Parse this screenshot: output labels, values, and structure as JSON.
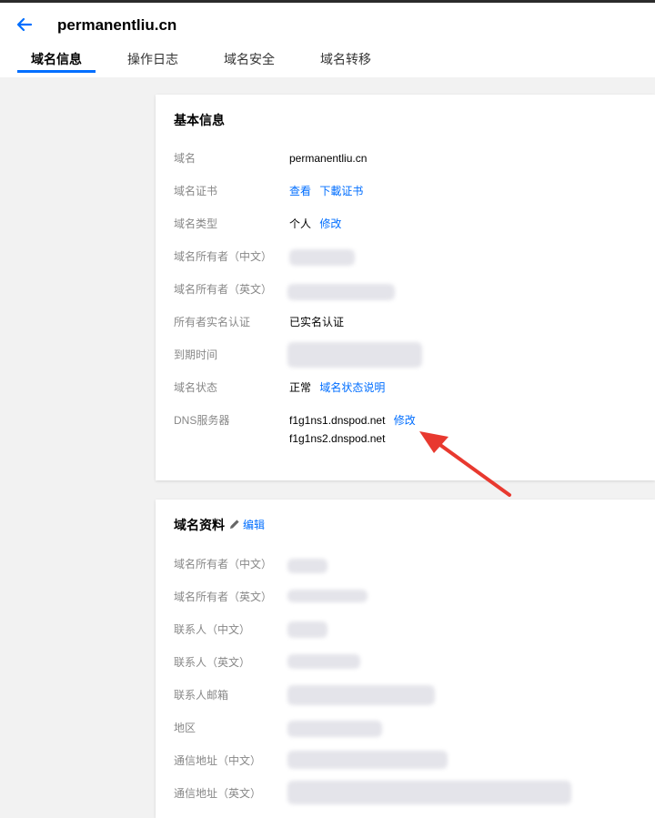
{
  "header": {
    "title": "permanentliu.cn",
    "tabs": [
      "域名信息",
      "操作日志",
      "域名安全",
      "域名转移"
    ]
  },
  "basic_info": {
    "title": "基本信息",
    "rows": [
      {
        "label": "域名",
        "value": "permanentliu.cn"
      },
      {
        "label": "域名证书",
        "link1": "查看",
        "link2": "下載证书"
      },
      {
        "label": "域名类型",
        "value": "个人",
        "link": "修改"
      },
      {
        "label": "域名所有者（中文）"
      },
      {
        "label": "域名所有者（英文）"
      },
      {
        "label": "所有者实名认证",
        "value": "已实名认证"
      },
      {
        "label": "到期时间"
      },
      {
        "label": "域名状态",
        "value": "正常",
        "link": "域名状态说明"
      },
      {
        "label": "DNS服务器",
        "dns1": "f1g1ns1.dnspod.net",
        "dns2": "f1g1ns2.dnspod.net",
        "link": "修改"
      }
    ]
  },
  "domain_profile": {
    "title": "域名资料",
    "edit_label": "编辑",
    "rows": [
      {
        "label": "域名所有者（中文）"
      },
      {
        "label": "域名所有者（英文）"
      },
      {
        "label": "联系人（中文）"
      },
      {
        "label": "联系人（英文）"
      },
      {
        "label": "联系人邮箱"
      },
      {
        "label": "地区"
      },
      {
        "label": "通信地址（中文）"
      },
      {
        "label": "通信地址（英文）"
      }
    ]
  },
  "colors": {
    "accent": "#006eff",
    "annotation_arrow": "#e8392f"
  },
  "icons": {
    "back": "arrow-left-icon",
    "edit": "pencil-icon"
  }
}
